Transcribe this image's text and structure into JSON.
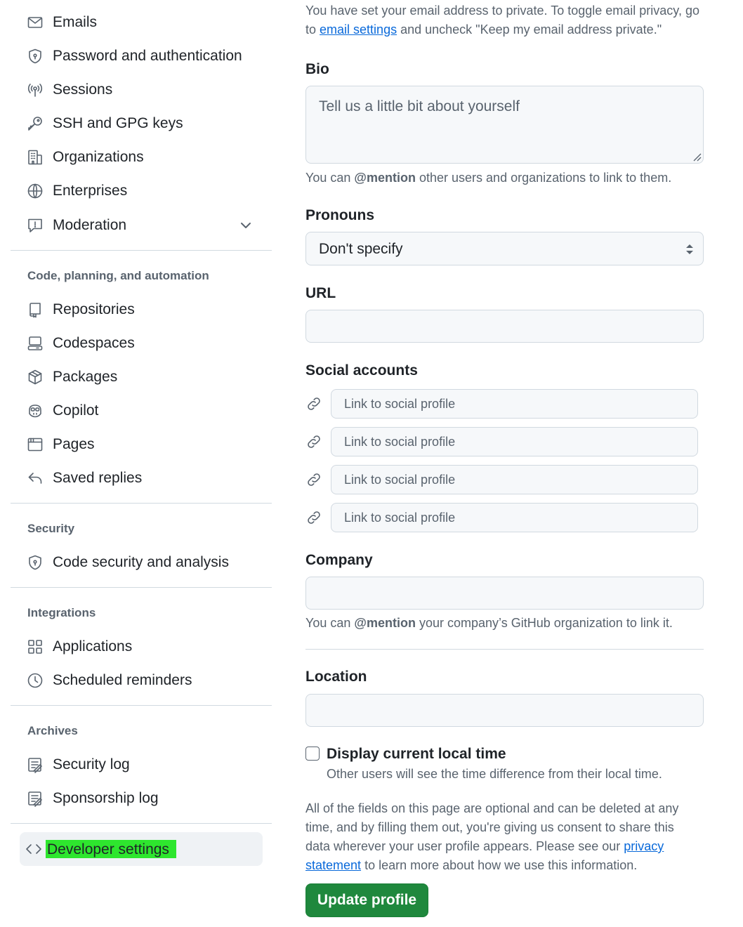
{
  "sidebar": {
    "items_top": [
      {
        "label": "Emails",
        "icon": "mail-icon"
      },
      {
        "label": "Password and authentication",
        "icon": "shield-lock-icon"
      },
      {
        "label": "Sessions",
        "icon": "broadcast-icon"
      },
      {
        "label": "SSH and GPG keys",
        "icon": "key-icon"
      },
      {
        "label": "Organizations",
        "icon": "organization-icon"
      },
      {
        "label": "Enterprises",
        "icon": "globe-icon"
      },
      {
        "label": "Moderation",
        "icon": "report-icon"
      }
    ],
    "section_code": {
      "heading": "Code, planning, and automation",
      "items": [
        {
          "label": "Repositories",
          "icon": "repo-icon"
        },
        {
          "label": "Codespaces",
          "icon": "codespaces-icon"
        },
        {
          "label": "Packages",
          "icon": "package-icon"
        },
        {
          "label": "Copilot",
          "icon": "copilot-icon"
        },
        {
          "label": "Pages",
          "icon": "browser-icon"
        },
        {
          "label": "Saved replies",
          "icon": "reply-icon"
        }
      ]
    },
    "section_security": {
      "heading": "Security",
      "items": [
        {
          "label": "Code security and analysis",
          "icon": "shield-lock-icon"
        }
      ]
    },
    "section_integrations": {
      "heading": "Integrations",
      "items": [
        {
          "label": "Applications",
          "icon": "apps-icon"
        },
        {
          "label": "Scheduled reminders",
          "icon": "clock-icon"
        }
      ]
    },
    "section_archives": {
      "heading": "Archives",
      "items": [
        {
          "label": "Security log",
          "icon": "log-icon"
        },
        {
          "label": "Sponsorship log",
          "icon": "log-icon"
        }
      ]
    },
    "developer_settings": {
      "label": "Developer settings",
      "icon": "code-icon"
    }
  },
  "main": {
    "email_note_part1": "You have set your email address to private. To toggle email privacy, go",
    "email_note_part2": "to",
    "email_note_link": "email settings",
    "email_note_part3": "and uncheck \"Keep my email address private.\"",
    "bio": {
      "label": "Bio",
      "placeholder": "Tell us a little bit about yourself",
      "help_prefix": "You can",
      "help_mention": "@mention",
      "help_suffix": "other users and organizations to link to them."
    },
    "pronouns": {
      "label": "Pronouns",
      "value": "Don't specify"
    },
    "url": {
      "label": "URL",
      "value": ""
    },
    "social": {
      "label": "Social accounts",
      "placeholders": [
        "Link to social profile",
        "Link to social profile",
        "Link to social profile",
        "Link to social profile"
      ]
    },
    "company": {
      "label": "Company",
      "value": "",
      "help_prefix": "You can",
      "help_mention": "@mention",
      "help_suffix": "your company’s GitHub organization to link it."
    },
    "location": {
      "label": "Location",
      "value": ""
    },
    "local_time": {
      "label": "Display current local time",
      "help": "Other users will see the time difference from their local time.",
      "checked": false
    },
    "disclaimer_line1": "All of the fields on this page are optional and can be deleted at any",
    "disclaimer_line2": "time, and by filling them out, you're giving us consent to share this",
    "disclaimer_line3": "data wherever your user profile appears. Please see our",
    "disclaimer_link_a": "privacy",
    "disclaimer_link_b": "statement",
    "disclaimer_line4": "to learn more about how we use this information.",
    "submit_label": "Update profile"
  },
  "colors": {
    "accent": "#0969da",
    "primary_button": "#1f883d",
    "highlight": "#2ee62e"
  }
}
